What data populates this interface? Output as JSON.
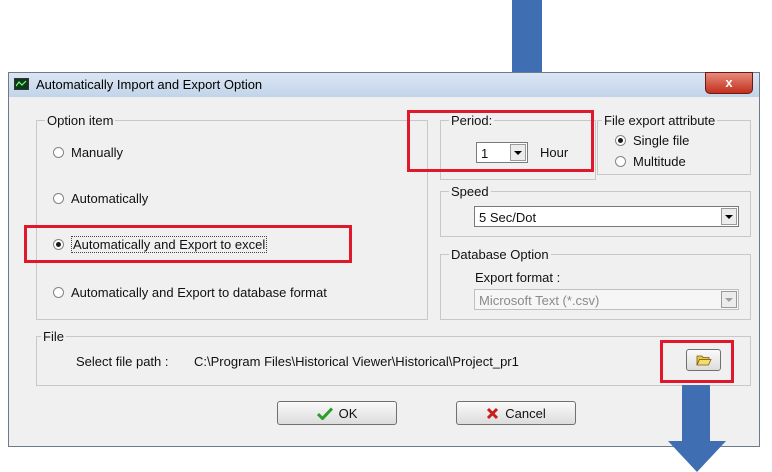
{
  "window": {
    "title": "Automatically Import and Export Option",
    "close_label": "x"
  },
  "option_group": {
    "legend": "Option item",
    "options": [
      {
        "label": "Manually",
        "selected": false
      },
      {
        "label": "Automatically",
        "selected": false
      },
      {
        "label": "Automatically and Export to excel",
        "selected": true
      },
      {
        "label": "Automatically and Export to database format",
        "selected": false
      }
    ]
  },
  "period": {
    "legend": "Period:",
    "value": "1",
    "unit": "Hour"
  },
  "file_export": {
    "legend": "File export attribute",
    "options": [
      {
        "label": "Single file",
        "selected": true
      },
      {
        "label": "Multitude",
        "selected": false
      }
    ]
  },
  "speed": {
    "legend": "Speed",
    "value": "5 Sec/Dot"
  },
  "database": {
    "legend": "Database Option",
    "format_label": "Export format :",
    "format_value": "Microsoft Text (*.csv)"
  },
  "file": {
    "legend": "File",
    "path_label": "Select file path :",
    "path_value": "C:\\Program Files\\Historical Viewer\\Historical\\Project_pr1",
    "browse_icon": "folder-open-icon"
  },
  "buttons": {
    "ok_label": "OK",
    "cancel_label": "Cancel"
  },
  "colors": {
    "callout": "#e0182b",
    "arrow": "#3f6eb3"
  }
}
